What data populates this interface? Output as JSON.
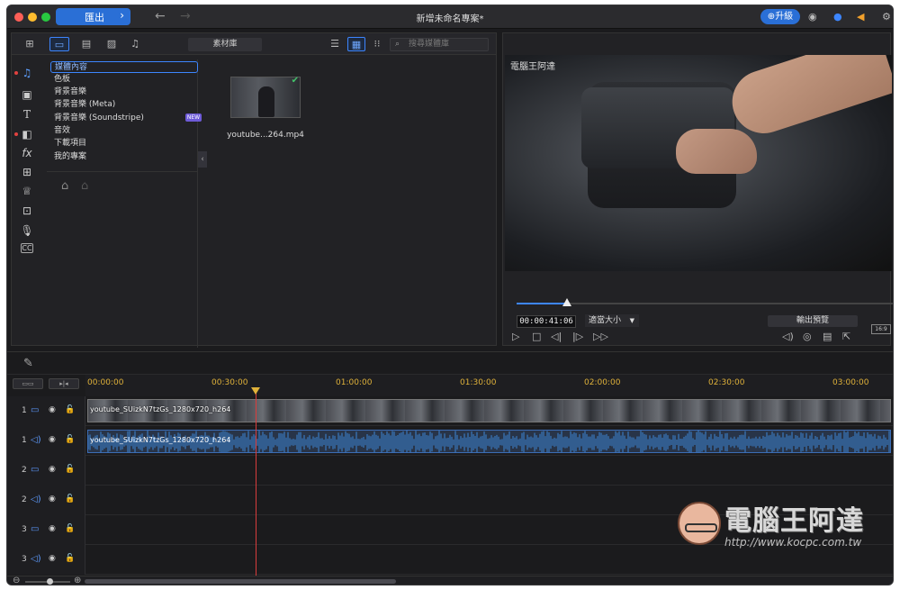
{
  "titlebar": {
    "export_label": "匯出",
    "export_chevron": "›",
    "title": "新增未命名專案*",
    "upgrade_label": "升級",
    "colors": {
      "close": "#ff5f57",
      "minimize": "#febc2e",
      "zoom": "#28c840",
      "accent": "#2a6fd6"
    }
  },
  "media_toolbar": {
    "library_label": "素材庫",
    "search_placeholder": "搜尋媒體庫"
  },
  "categories": [
    "媒體內容",
    "色板",
    "背景音樂",
    "背景音樂 (Meta)",
    "背景音樂 (Soundstripe)",
    "音效",
    "下載項目",
    "我的專案"
  ],
  "new_badge": "NEW",
  "media_item": {
    "filename": "youtube...264.mp4"
  },
  "preview": {
    "watermark": "電腦王阿達",
    "scrub_fraction": 0.14,
    "timecode": "00:00:41:06",
    "fit_label": "適當大小",
    "export_preview_label": "輸出預覽",
    "aspect": "16:9"
  },
  "ruler": {
    "labels": [
      "00:00:00",
      "00:30:00",
      "01:00:00",
      "01:30:00",
      "02:00:00",
      "02:30:00",
      "03:00:00"
    ]
  },
  "tracks": [
    {
      "num": "1",
      "kind": "video"
    },
    {
      "num": "1",
      "kind": "audio"
    },
    {
      "num": "2",
      "kind": "video"
    },
    {
      "num": "2",
      "kind": "audio"
    },
    {
      "num": "3",
      "kind": "video"
    },
    {
      "num": "3",
      "kind": "audio"
    }
  ],
  "clips": {
    "video_label": "youtube_SUizkN7tzGs_1280x720_h264",
    "audio_label": "youtube_SUizkN7tzGs_1280x720_h264"
  },
  "watermark": {
    "text": "電腦王阿達",
    "url": "http://www.kocpc.com.tw"
  }
}
